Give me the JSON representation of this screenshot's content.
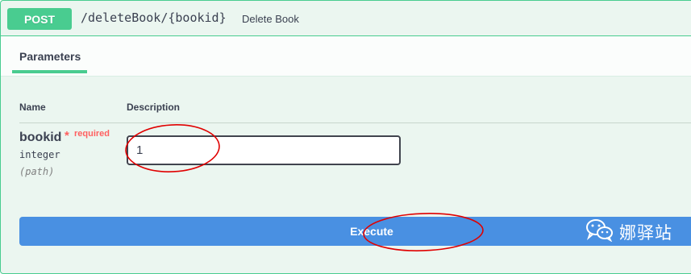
{
  "operation": {
    "method": "POST",
    "path": "/deleteBook/{bookid}",
    "summary": "Delete Book",
    "method_color": "#49cc90"
  },
  "tabs": {
    "parameters": "Parameters"
  },
  "table": {
    "headers": {
      "name": "Name",
      "description": "Description"
    },
    "parameter": {
      "name": "bookid",
      "asterisk": "*",
      "required": "required",
      "type": "integer",
      "in": "(path)",
      "value": "1"
    }
  },
  "execute_label": "Execute",
  "watermark": {
    "icon": "wechat-icon",
    "text": "娜驿站"
  },
  "annotations": {
    "color": "#e00000",
    "count": 2
  },
  "colors": {
    "block_bg": "#ebf6f0",
    "execute": "#4990e2",
    "required": "#ff6060"
  }
}
